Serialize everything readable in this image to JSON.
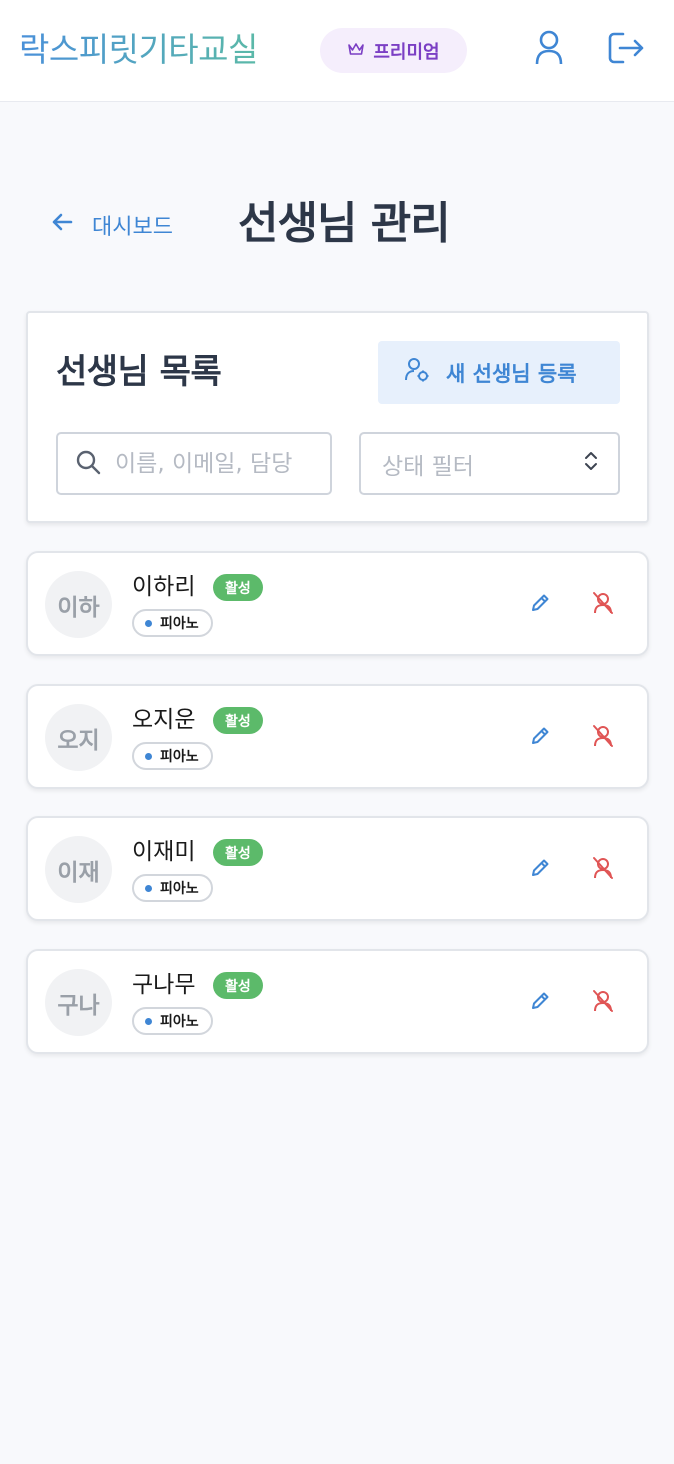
{
  "app": {
    "brand": "락스피릿기타교실",
    "premium_label": "프리미엄"
  },
  "nav": {
    "back_label": "대시보드"
  },
  "page": {
    "title": "선생님 관리"
  },
  "panel": {
    "title": "선생님 목록",
    "add_button_label": "새 선생님 등록",
    "search_placeholder": "이름, 이메일, 담당",
    "filter_placeholder": "상태 필터"
  },
  "teachers": [
    {
      "initials": "이하",
      "name": "이하리",
      "status": "활성",
      "subject": "피아노"
    },
    {
      "initials": "오지",
      "name": "오지운",
      "status": "활성",
      "subject": "피아노"
    },
    {
      "initials": "이재",
      "name": "이재미",
      "status": "활성",
      "subject": "피아노"
    },
    {
      "initials": "구나",
      "name": "구나무",
      "status": "활성",
      "subject": "피아노"
    }
  ],
  "icons": {
    "premium": "crown-icon",
    "user": "user-icon",
    "logout": "logout-icon",
    "back": "arrow-left-icon",
    "add": "user-add-icon",
    "search": "search-icon",
    "filter": "chevron-up-down-icon",
    "edit": "pencil-icon",
    "deactivate": "user-off-icon"
  },
  "colors": {
    "accent": "#3f86d4",
    "premium": "#7b3fc4",
    "status_active": "#5cba6a",
    "danger": "#e05555"
  }
}
